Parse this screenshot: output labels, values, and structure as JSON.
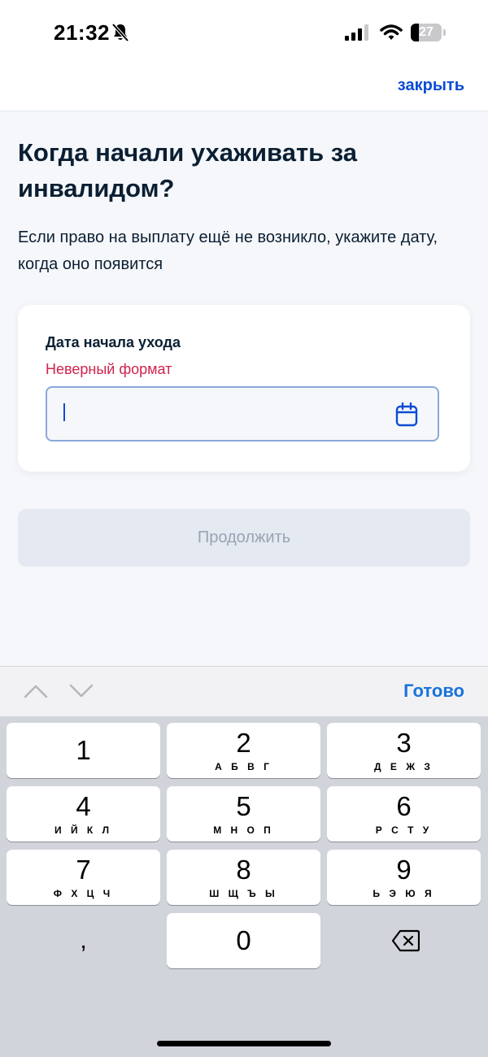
{
  "status_bar": {
    "time": "21:32",
    "battery_level": "27",
    "battery_fraction": 0.27,
    "icons": [
      "bell-off-icon",
      "signal-icon",
      "wifi-icon",
      "battery-icon"
    ]
  },
  "header": {
    "close_label": "закрыть"
  },
  "main": {
    "title": "Когда начали ухаживать за инвалидом?",
    "description": "Если право на выплату ещё не возникло, укажите дату, когда оно появится",
    "field": {
      "label": "Дата начала ухода",
      "error": "Неверный формат",
      "value": "",
      "icon": "calendar-icon"
    },
    "continue_label": "Продолжить"
  },
  "keyboard_toolbar": {
    "done_label": "Готово",
    "icons": [
      "chevron-up-icon",
      "chevron-down-icon"
    ]
  },
  "keyboard": {
    "keys": [
      {
        "digit": "1",
        "letters": ""
      },
      {
        "digit": "2",
        "letters": "А Б В Г"
      },
      {
        "digit": "3",
        "letters": "Д Е Ж З"
      },
      {
        "digit": "4",
        "letters": "И Й К Л"
      },
      {
        "digit": "5",
        "letters": "М Н О П"
      },
      {
        "digit": "6",
        "letters": "Р С Т У"
      },
      {
        "digit": "7",
        "letters": "Ф Х Ц Ч"
      },
      {
        "digit": "8",
        "letters": "Ш Щ Ъ Ы"
      },
      {
        "digit": "9",
        "letters": "Ь Э Ю Я"
      },
      {
        "digit": "0",
        "letters": ""
      }
    ],
    "comma": ",",
    "delete_icon": "backspace-icon"
  },
  "colors": {
    "accent": "#0d4cd3",
    "error": "#d0234b",
    "done": "#1a73d9",
    "text": "#0b1f33"
  }
}
